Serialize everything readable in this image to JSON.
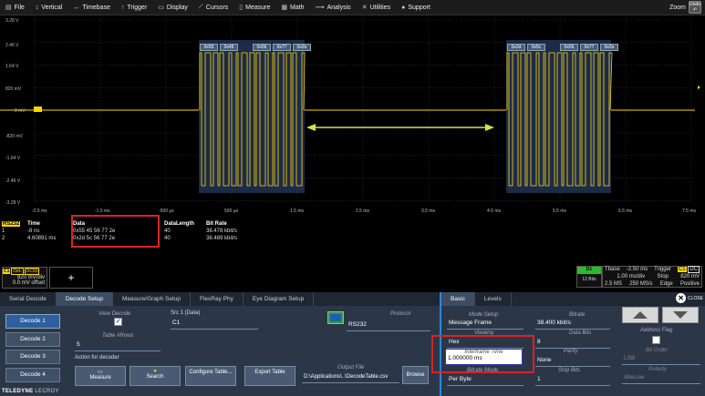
{
  "menu": {
    "items": [
      {
        "label": "File",
        "icon": "file-icon"
      },
      {
        "label": "Vertical",
        "icon": "vertical-icon"
      },
      {
        "label": "Timebase",
        "icon": "timebase-icon"
      },
      {
        "label": "Trigger",
        "icon": "trigger-icon"
      },
      {
        "label": "Display",
        "icon": "display-icon"
      },
      {
        "label": "Cursors",
        "icon": "cursors-icon"
      },
      {
        "label": "Measure",
        "icon": "measure-icon"
      },
      {
        "label": "Math",
        "icon": "math-icon"
      },
      {
        "label": "Analysis",
        "icon": "analysis-icon"
      },
      {
        "label": "Utilities",
        "icon": "utilities-icon"
      },
      {
        "label": "Support",
        "icon": "support-icon"
      }
    ],
    "zoom_label": "Zoom",
    "undo_label": "Undo"
  },
  "grid": {
    "y_labels": [
      "3.28 V",
      "2.46 V",
      "1.64 V",
      "820 mV",
      "0 mV",
      "-820 mV",
      "-1.64 V",
      "-2.46 V",
      "-3.28 V"
    ],
    "x_labels": [
      "-2.5 ms",
      "-1.5 ms",
      "-500 µs",
      "500 µs",
      "1.5 ms",
      "2.5 ms",
      "3.5 ms",
      "4.5 ms",
      "5.5 ms",
      "6.5 ms",
      "7.5 ms"
    ],
    "packet_labels_left": [
      "0x55",
      "0x45",
      "0x56",
      "0x77",
      "0x2e"
    ],
    "packet_labels_right": [
      "0x2d",
      "0x5c",
      "0x56",
      "0x77",
      "0x2e"
    ],
    "trace_color": "#ffd700",
    "arrow_color": "#c8e650"
  },
  "decode_table": {
    "tag": "RS232",
    "headers": [
      "Time",
      "Data",
      "DataLength",
      "Bit Rate"
    ],
    "rows": [
      {
        "idx": "1",
        "time": "-8 ns",
        "data": "0x55 45 56 77 2e",
        "length": "40",
        "bitrate": "38.478 kbit/s"
      },
      {
        "idx": "2",
        "time": "4.60891 ms",
        "data": "0x2d 5c 56 77 2e",
        "length": "40",
        "bitrate": "38.489 kbit/s"
      }
    ]
  },
  "channel": {
    "tag": "C1",
    "badges": [
      "DeL",
      "DC50"
    ],
    "vdiv": "820 mV/div",
    "offset": "0.0 mV offset",
    "plus": "+"
  },
  "status": {
    "dec_tag": "D1",
    "bits": "12 Bits",
    "tbase_label": "Tbase",
    "tbase_value": "-2.50 ms",
    "trigger_label": "Trigger",
    "trigger_tags": [
      "C1",
      "DC"
    ],
    "timediv": "1.00 ms/div",
    "stop": "Stop",
    "trig_level": "820 mV",
    "samples": "2.5 MS",
    "rate": "250 MS/s",
    "edge": "Edge",
    "slope": "Positive"
  },
  "panel": {
    "tabs": [
      "Serial Decode",
      "Decode Setup",
      "Measure/Graph Setup",
      "FlexRay Phy",
      "Eye Diagram Setup"
    ],
    "right_tabs": [
      "Basic",
      "Levels"
    ],
    "close_label": "CLOSE",
    "decode_buttons": [
      "Decode 1",
      "Decode 2",
      "Decode 3",
      "Decode 4"
    ],
    "view_decode_label": "View Decode",
    "check": "✓",
    "table_rows_label": "Table #Rows",
    "table_rows_value": "5",
    "src_label": "Src 1 (Data)",
    "src_value": "C1",
    "protocol_label": "Protocol",
    "protocol_value": "RS232",
    "action_label": "Action for decoder",
    "measure_btn": "Measure",
    "search_btn": "Search",
    "configure_btn": "Configure Table...",
    "export_btn": "Export Table",
    "output_file_label": "Output File",
    "output_file_value": "D:\\Applications\\..\\DecodeTable.csv",
    "browse_btn": "Browse",
    "mode_setup_label": "Mode Setup",
    "mode_setup_value": "Message Frame",
    "bitrate_label": "Bitrate",
    "bitrate_value": "38.400 kbit/s",
    "viewing_label": "Viewing",
    "viewing_value": "Hex",
    "data_bits_label": "Data Bits",
    "data_bits_value": "8",
    "interframe_label": "Interframe Time",
    "interframe_value": "1.000000 ms",
    "parity_label": "Parity",
    "parity_value": "None",
    "bitrate_mode_label": "Bitrate Mode",
    "bitrate_mode_value": "Per Byte",
    "stop_bits_label": "Stop Bits",
    "stop_bits_value": "1",
    "address_flag_label": "Address Flag",
    "bit_order_label": "Bit Order",
    "bit_order_value": "LSB",
    "polarity_label": "Polarity",
    "polarity_value": "IdleLow"
  },
  "logo": {
    "brand": "TELEDYNE",
    "sub": "LECROY"
  }
}
